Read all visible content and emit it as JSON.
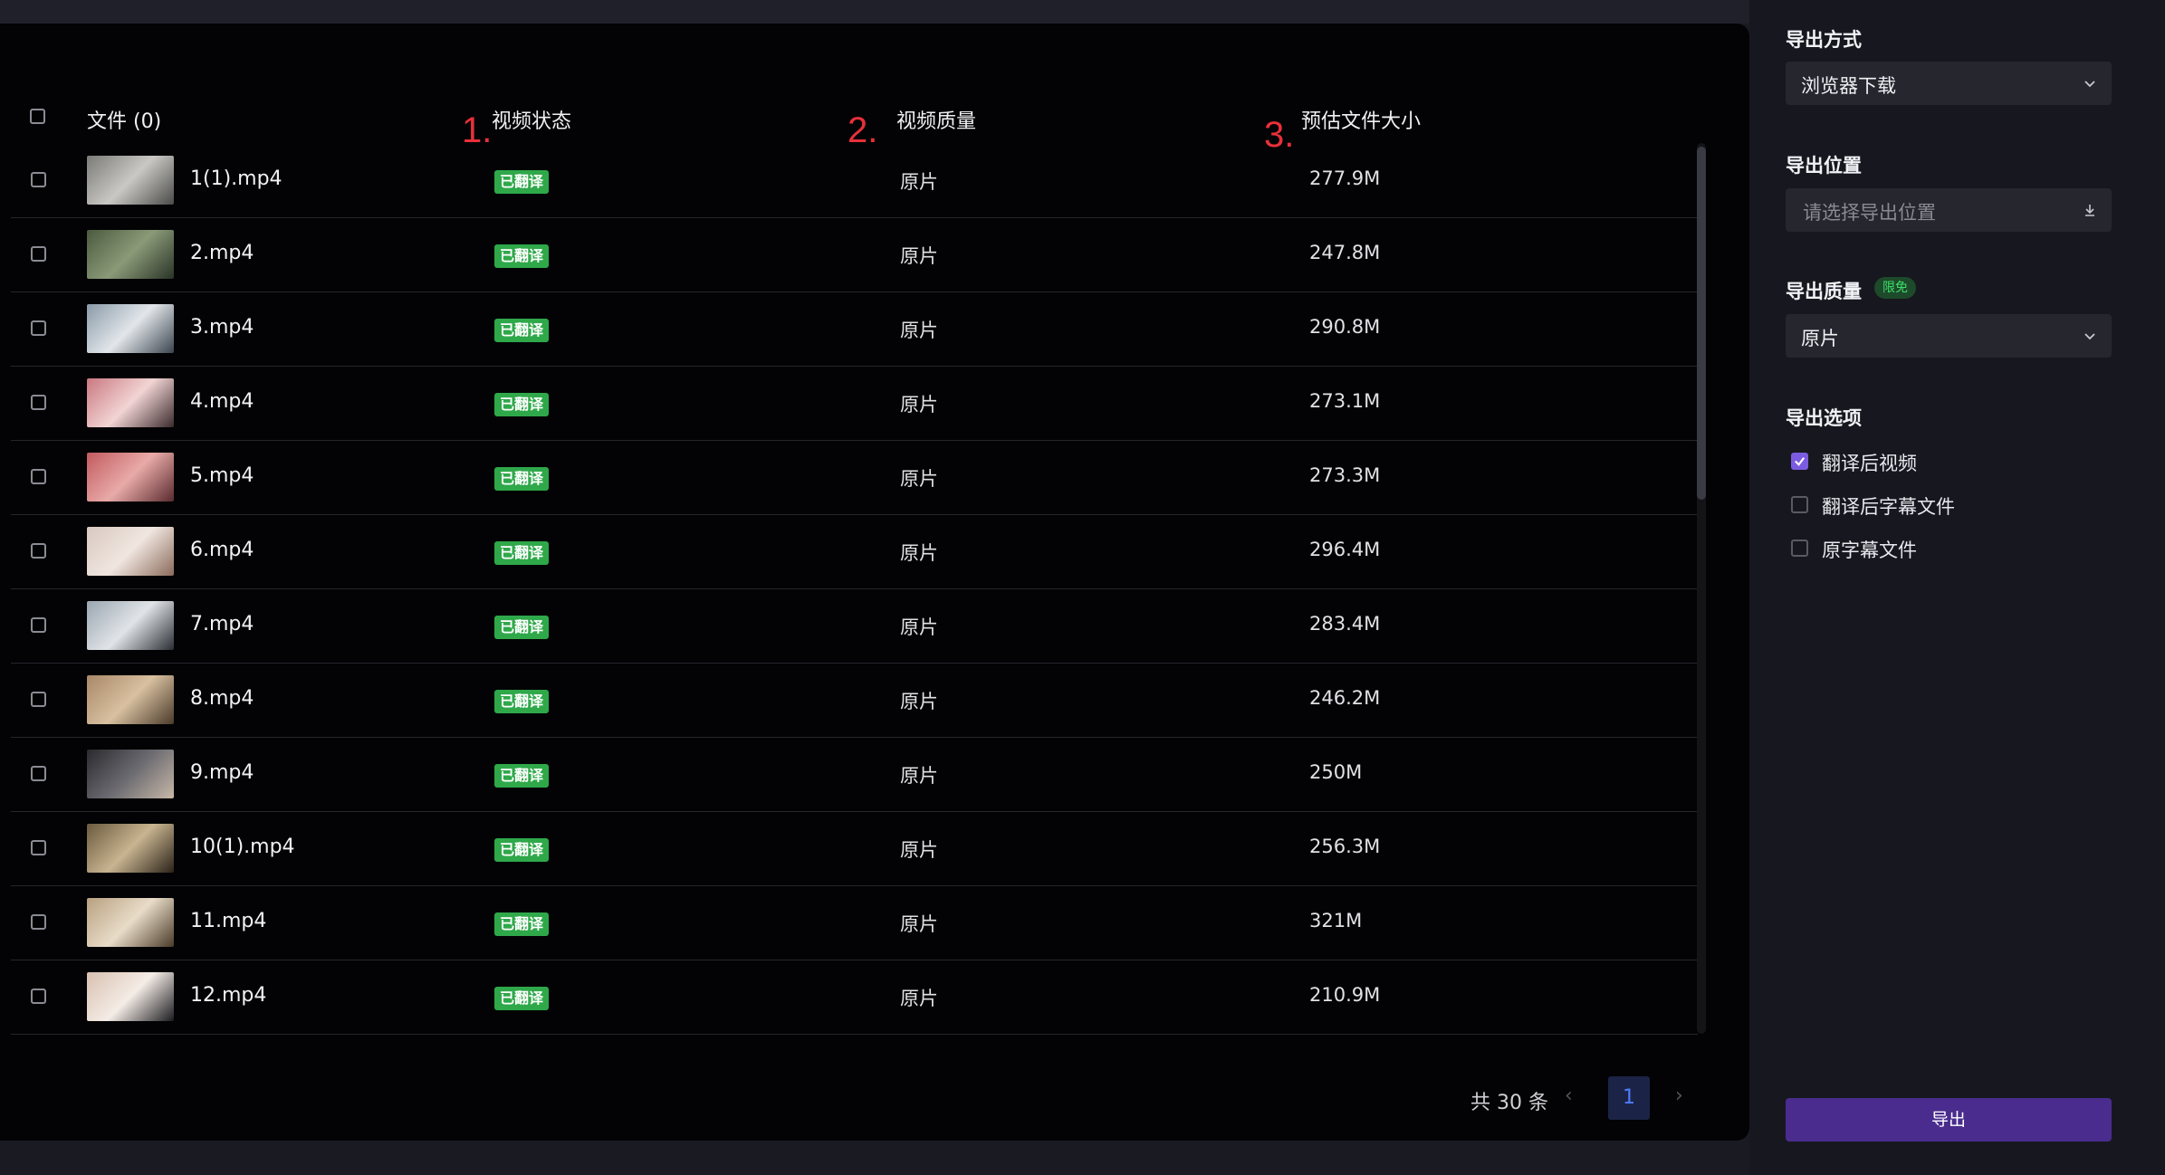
{
  "table": {
    "headers": {
      "file": "文件 (0)",
      "status": "视频状态",
      "quality": "视频质量",
      "size": "预估文件大小"
    },
    "markers": [
      "1.",
      "2.",
      "3."
    ],
    "rows": [
      {
        "name": "1(1).mp4",
        "status": "已翻译",
        "quality": "原片",
        "size": "277.9M"
      },
      {
        "name": "2.mp4",
        "status": "已翻译",
        "quality": "原片",
        "size": "247.8M"
      },
      {
        "name": "3.mp4",
        "status": "已翻译",
        "quality": "原片",
        "size": "290.8M"
      },
      {
        "name": "4.mp4",
        "status": "已翻译",
        "quality": "原片",
        "size": "273.1M"
      },
      {
        "name": "5.mp4",
        "status": "已翻译",
        "quality": "原片",
        "size": "273.3M"
      },
      {
        "name": "6.mp4",
        "status": "已翻译",
        "quality": "原片",
        "size": "296.4M"
      },
      {
        "name": "7.mp4",
        "status": "已翻译",
        "quality": "原片",
        "size": "283.4M"
      },
      {
        "name": "8.mp4",
        "status": "已翻译",
        "quality": "原片",
        "size": "246.2M"
      },
      {
        "name": "9.mp4",
        "status": "已翻译",
        "quality": "原片",
        "size": "250M"
      },
      {
        "name": "10(1).mp4",
        "status": "已翻译",
        "quality": "原片",
        "size": "256.3M"
      },
      {
        "name": "11.mp4",
        "status": "已翻译",
        "quality": "原片",
        "size": "321M"
      },
      {
        "name": "12.mp4",
        "status": "已翻译",
        "quality": "原片",
        "size": "210.9M"
      }
    ]
  },
  "pagination": {
    "total": "共 30 条",
    "current_page": "1"
  },
  "settings": {
    "export_method_label": "导出方式",
    "export_method_value": "浏览器下载",
    "export_location_label": "导出位置",
    "export_location_placeholder": "请选择导出位置",
    "export_quality_label": "导出质量",
    "export_quality_badge": "限免",
    "export_quality_value": "原片",
    "export_options_label": "导出选项",
    "options": [
      {
        "label": "翻译后视频",
        "checked": true
      },
      {
        "label": "翻译后字幕文件",
        "checked": false
      },
      {
        "label": "原字幕文件",
        "checked": false
      }
    ],
    "export_button": "导出"
  },
  "colors": {
    "accent": "#4a2c8e",
    "status_badge": "#2fa84a",
    "page_active": "#4f7cff",
    "checkbox_checked": "#7b5ce0"
  }
}
